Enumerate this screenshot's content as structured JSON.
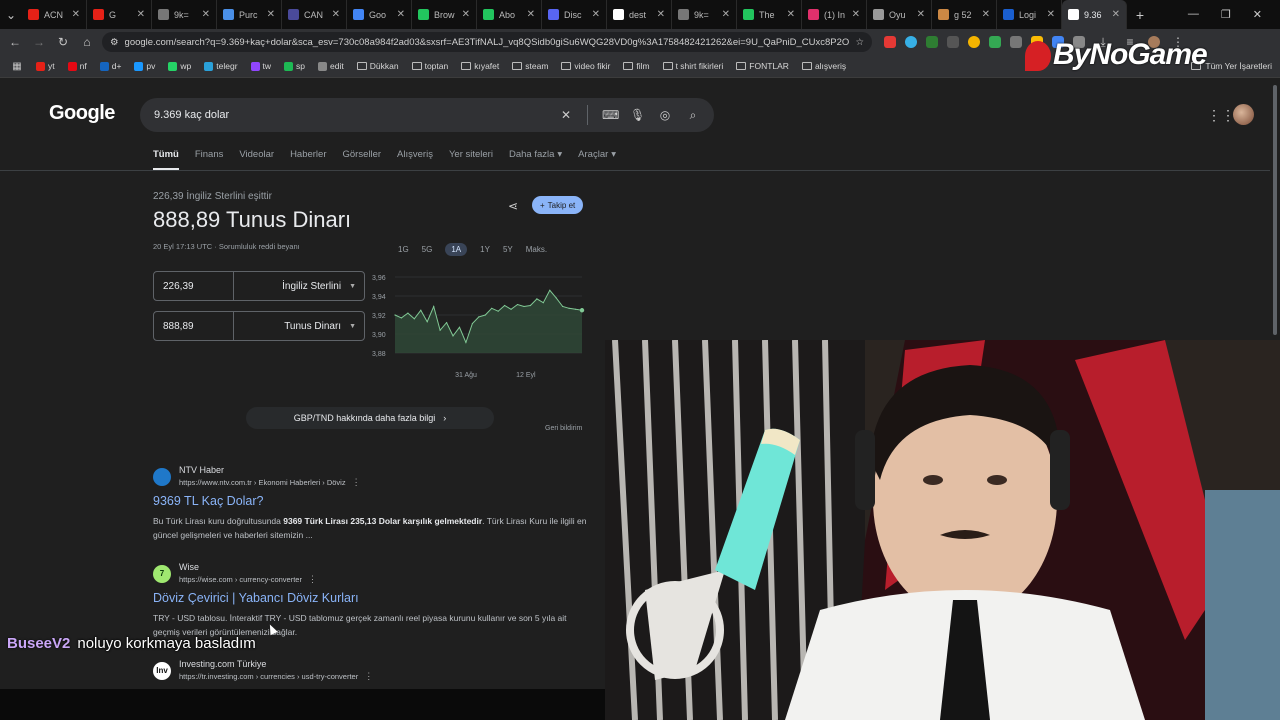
{
  "tabs": [
    {
      "label": "ACN",
      "color": "#e62117"
    },
    {
      "label": "G",
      "color": "#e62117"
    },
    {
      "label": "9k=",
      "color": "#777777"
    },
    {
      "label": "Purc",
      "color": "#4a8fe7"
    },
    {
      "label": "CAN",
      "color": "#4a4a9a"
    },
    {
      "label": "Goo",
      "color": "#4285f4"
    },
    {
      "label": "Brow",
      "color": "#22c55e"
    },
    {
      "label": "Abo",
      "color": "#22c55e"
    },
    {
      "label": "Disc",
      "color": "#5865f2"
    },
    {
      "label": "dest",
      "color": "#ffffff"
    },
    {
      "label": "9k=",
      "color": "#777777"
    },
    {
      "label": "The",
      "color": "#22c55e"
    },
    {
      "label": "(1) In",
      "color": "#e1306c"
    },
    {
      "label": "Oyu",
      "color": "#999999"
    },
    {
      "label": "g 52",
      "color": "#cc8844"
    },
    {
      "label": "Logi",
      "color": "#1a5fd0"
    },
    {
      "label": "9.36",
      "color": "#ffffff",
      "active": true
    }
  ],
  "address": {
    "url": "google.com/search?q=9.369+kaç+dolar&sca_esv=730c08a984f2ad03&sxsrf=AE3TifNALJ_vq8QSidb0giSu6WQG28VD0g%3A1758482421262&ei=9U_QaPniD_CUxc8P2Oq_s..."
  },
  "bookmarks": [
    {
      "label": "yt",
      "type": "icon",
      "color": "#e62117"
    },
    {
      "label": "nf",
      "type": "icon",
      "color": "#e50914"
    },
    {
      "label": "d+",
      "type": "icon",
      "color": "#1565c0"
    },
    {
      "label": "pv",
      "type": "icon",
      "color": "#1a98ff"
    },
    {
      "label": "wp",
      "type": "icon",
      "color": "#25d366"
    },
    {
      "label": "telegr",
      "type": "icon",
      "color": "#2aa1da"
    },
    {
      "label": "tw",
      "type": "icon",
      "color": "#9146ff"
    },
    {
      "label": "sp",
      "type": "icon",
      "color": "#1db954"
    },
    {
      "label": "edit",
      "type": "icon",
      "color": "#888888"
    },
    {
      "label": "Dükkan",
      "type": "folder"
    },
    {
      "label": "toptan",
      "type": "folder"
    },
    {
      "label": "kıyafet",
      "type": "folder"
    },
    {
      "label": "steam",
      "type": "folder"
    },
    {
      "label": "video fikir",
      "type": "folder"
    },
    {
      "label": "film",
      "type": "folder"
    },
    {
      "label": "t shirt fikirleri",
      "type": "folder"
    },
    {
      "label": "FONTLAR",
      "type": "folder"
    },
    {
      "label": "alışveriş",
      "type": "folder"
    }
  ],
  "bookmarks_all": "Tüm Yer İşaretleri",
  "watermark": "ByNoGame",
  "google": {
    "logo": "Google",
    "query": "9.369 kaç dolar"
  },
  "search_tabs": [
    "Tümü",
    "Finans",
    "Videolar",
    "Haberler",
    "Görseller",
    "Alışveriş",
    "Yer siteleri",
    "Daha fazla",
    "Araçlar"
  ],
  "converter": {
    "subtitle": "226,39 İngiliz Sterlini eşittir",
    "result": "888,89 Tunus Dinarı",
    "date": "20 Eyl 17:13 UTC · Sorumluluk reddi beyanı",
    "follow": "Takip et",
    "ranges": [
      "1G",
      "5G",
      "1A",
      "1Y",
      "5Y",
      "Maks."
    ],
    "active_range": "1A",
    "from": {
      "value": "226,39",
      "currency": "İngiliz Sterlini"
    },
    "to": {
      "value": "888,89",
      "currency": "Tunus Dinarı"
    },
    "more": "GBP/TND hakkında daha fazla bilgi",
    "feedback": "Geri bildirim"
  },
  "chart_data": {
    "type": "line",
    "ylim": [
      3.88,
      3.96
    ],
    "yticks": [
      "3,96",
      "3,94",
      "3,92",
      "3,90",
      "3,88"
    ],
    "xticks": [
      "31 Ağu",
      "12 Eyl"
    ],
    "values": [
      3.92,
      3.917,
      3.922,
      3.916,
      3.925,
      3.913,
      3.929,
      3.904,
      3.912,
      3.898,
      3.907,
      3.891,
      3.911,
      3.918,
      3.92,
      3.927,
      3.924,
      3.93,
      3.926,
      3.931,
      3.929,
      3.93,
      3.937,
      3.933,
      3.946,
      3.938,
      3.929,
      3.927,
      3.926,
      3.925
    ]
  },
  "results": [
    {
      "source": "NTV Haber",
      "url": "https://www.ntv.com.tr › Ekonomi Haberleri › Döviz",
      "title": "9369 TL Kaç Dolar?",
      "snippet_pre": "Bu Türk Lirası kuru doğrultusunda ",
      "snippet_bold": "9369 Türk Lirası 235,13 Dolar karşılık gelmektedir",
      "snippet_post": ". Türk Lirası Kuru ile ilgili en güncel gelişmeleri ve haberleri sitemizin ...",
      "icon_text": "",
      "icon_color": "#1f78c9"
    },
    {
      "source": "Wise",
      "url": "https://wise.com › currency-converter",
      "title": "Döviz Çevirici | Yabancı Döviz Kurları",
      "snippet_pre": "TRY - USD tablosu. İnteraktif TRY - USD tablomuz gerçek zamanlı reel piyasa kurunu kullanır ve son 5 yıla ait geçmiş verileri görüntülemenizi sağlar.",
      "snippet_bold": "",
      "snippet_post": "",
      "icon_text": "7",
      "icon_color": "#9fe870"
    },
    {
      "source": "Investing.com Türkiye",
      "url": "https://tr.investing.com › currencies › usd-try-converter",
      "title": "",
      "snippet_pre": "",
      "snippet_bold": "",
      "snippet_post": "",
      "icon_text": "Inv",
      "icon_color": "#ffffff"
    }
  ],
  "chat": {
    "user": "BuseeV2",
    "message": "noluyo korkmaya basladım"
  }
}
